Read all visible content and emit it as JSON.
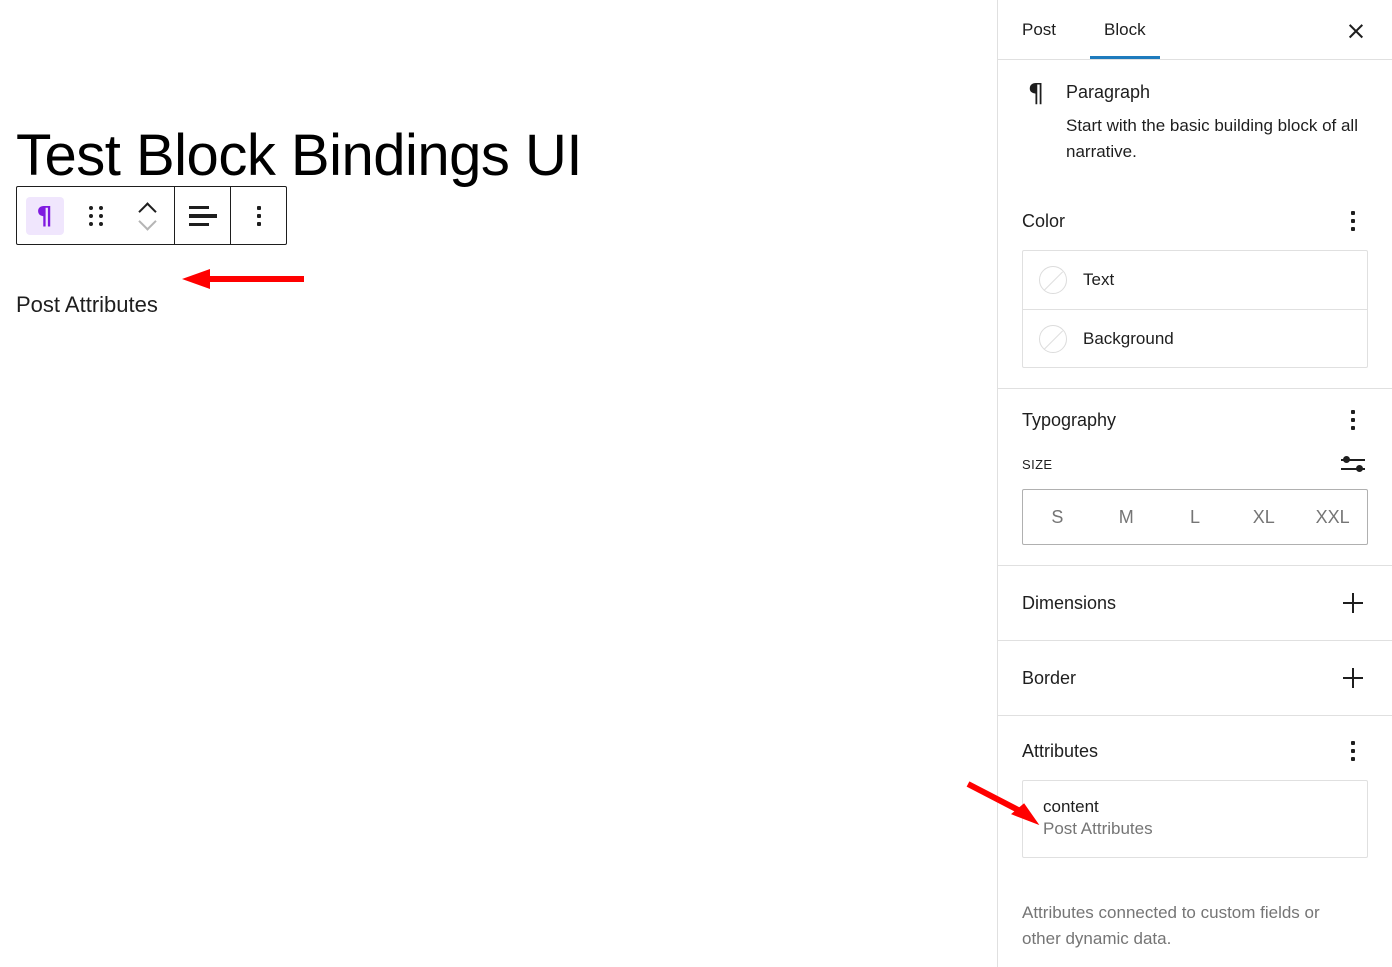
{
  "editor": {
    "post_title": "Test Block Bindings UI",
    "post_body": "Post Attributes",
    "toolbar": {
      "block_type_label": "Paragraph",
      "block_type_icon": "pilcrow-icon",
      "pilcrow_glyph": "¶",
      "drag_handle_label": "Drag",
      "move_up_label": "Move up",
      "move_down_label": "Move down",
      "align_label": "Align text",
      "options_label": "Options"
    },
    "accent_purple": "#7f1ae0",
    "accent_purple_bg": "#f0e6fd"
  },
  "annotations": {
    "arrow_color": "#ff0000",
    "arrow_body_label": "arrow pointing to post body text",
    "arrow_attribute_label": "arrow pointing to content attribute"
  },
  "sidebar": {
    "tabs": [
      {
        "label": "Post",
        "active": false
      },
      {
        "label": "Block",
        "active": true
      }
    ],
    "close_label": "×",
    "active_tab_underline_color": "#1e7bbd",
    "block_card": {
      "icon": "pilcrow-icon",
      "icon_glyph": "¶",
      "title": "Paragraph",
      "description": "Start with the basic building block of all narrative."
    },
    "color": {
      "title": "Color",
      "options_icon": "vertical-ellipsis-icon",
      "rows": [
        {
          "label": "Text",
          "swatch": "none"
        },
        {
          "label": "Background",
          "swatch": "none"
        }
      ]
    },
    "typography": {
      "title": "Typography",
      "options_icon": "vertical-ellipsis-icon",
      "size_label": "SIZE",
      "size_settings_icon": "sliders-icon",
      "sizes": [
        "S",
        "M",
        "L",
        "XL",
        "XXL"
      ],
      "selected_size": null
    },
    "dimensions": {
      "title": "Dimensions",
      "toggle_icon": "plus-icon"
    },
    "border": {
      "title": "Border",
      "toggle_icon": "plus-icon"
    },
    "attributes": {
      "title": "Attributes",
      "options_icon": "vertical-ellipsis-icon",
      "rows": [
        {
          "key": "content",
          "value": "Post Attributes"
        }
      ],
      "help_text": "Attributes connected to custom fields or other dynamic data."
    }
  }
}
